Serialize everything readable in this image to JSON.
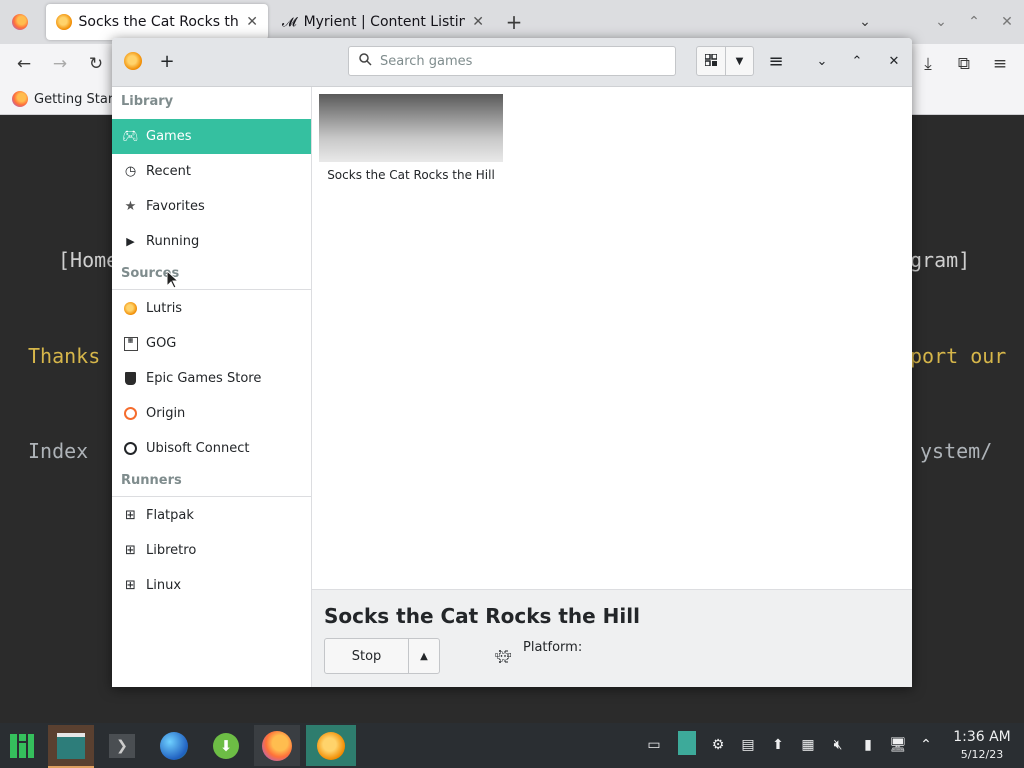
{
  "browser": {
    "tabs": [
      {
        "title": "Socks the Cat Rocks the Hil"
      },
      {
        "title": "Myrient | Content Listing"
      }
    ],
    "bookmarks": [
      {
        "label": "Getting Start"
      }
    ]
  },
  "website": {
    "lines": [
      {
        "text": "[Home"
      },
      {
        "text": "gram]"
      },
      {
        "text": "Thanks"
      },
      {
        "text": "port our"
      },
      {
        "text": "Index "
      },
      {
        "text": "ystem/"
      }
    ],
    "colors": {
      "bg": "#2b2b2b",
      "text": "#cfcfcf",
      "accent": "#d6b64a"
    }
  },
  "lutris": {
    "search_placeholder": "Search games",
    "sidebar": {
      "library_heading": "Library",
      "library": [
        {
          "label": "Games",
          "icon": "gamepad-icon",
          "active": true
        },
        {
          "label": "Recent",
          "icon": "clock-icon"
        },
        {
          "label": "Favorites",
          "icon": "star-icon"
        },
        {
          "label": "Running",
          "icon": "play-icon"
        }
      ],
      "sources_heading": "Sources",
      "sources": [
        {
          "label": "Lutris",
          "icon": "lutris-icon"
        },
        {
          "label": "GOG",
          "icon": "gog-icon"
        },
        {
          "label": "Epic Games Store",
          "icon": "epic-icon"
        },
        {
          "label": "Origin",
          "icon": "origin-icon"
        },
        {
          "label": "Ubisoft Connect",
          "icon": "ubisoft-icon"
        }
      ],
      "runners_heading": "Runners",
      "runners": [
        {
          "label": "Flatpak",
          "icon": "runner-icon"
        },
        {
          "label": "Libretro",
          "icon": "runner-icon"
        },
        {
          "label": "Linux",
          "icon": "runner-icon"
        }
      ]
    },
    "games": [
      {
        "title": "Socks the Cat Rocks the Hill"
      }
    ],
    "bottom": {
      "title": "Socks the Cat Rocks the Hill",
      "stop_label": "Stop",
      "platform_label": "Platform:"
    },
    "accent_color": "#35c0a0"
  },
  "taskbar": {
    "time": "1:36 AM",
    "date": "5/12/23"
  }
}
